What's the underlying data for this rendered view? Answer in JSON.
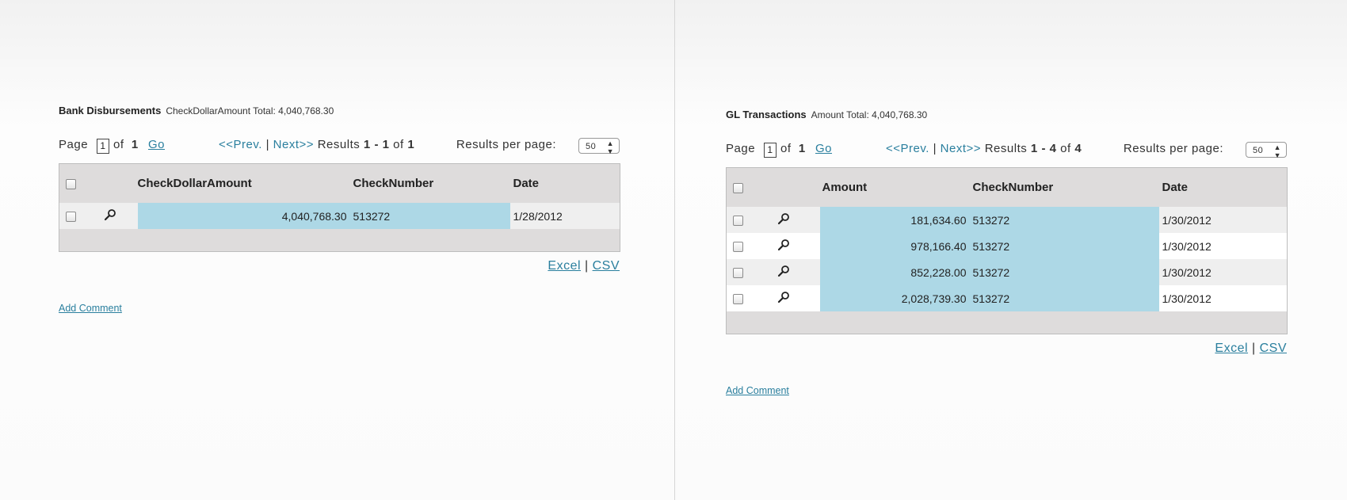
{
  "left": {
    "title": "Bank Disbursements",
    "total": "CheckDollarAmount Total: 4,040,768.30",
    "pager": {
      "page_label": "Page",
      "page_value": "1",
      "of_label": "of",
      "page_count": "1",
      "go": "Go",
      "prev": "<<Prev.",
      "sep": "|",
      "next": "Next>>",
      "results_label": "Results",
      "results_from": "1",
      "results_dash": "-",
      "results_to": "1",
      "results_of": "of",
      "results_total": "1",
      "rpp_label": "Results per page:",
      "rpp_value": "50"
    },
    "columns": [
      "CheckDollarAmount",
      "CheckNumber",
      "Date"
    ],
    "rows": [
      {
        "amount": "4,040,768.30",
        "check": "513272",
        "date": "1/28/2012"
      }
    ],
    "export": {
      "excel": "Excel",
      "sep": "|",
      "csv": "CSV"
    },
    "add_comment": "Add Comment"
  },
  "right": {
    "title": "GL Transactions",
    "total": "Amount Total: 4,040,768.30",
    "pager": {
      "page_label": "Page",
      "page_value": "1",
      "of_label": "of",
      "page_count": "1",
      "go": "Go",
      "prev": "<<Prev.",
      "sep": "|",
      "next": "Next>>",
      "results_label": "Results",
      "results_from": "1",
      "results_dash": "-",
      "results_to": "4",
      "results_of": "of",
      "results_total": "4",
      "rpp_label": "Results per page:",
      "rpp_value": "50"
    },
    "columns": [
      "Amount",
      "CheckNumber",
      "Date"
    ],
    "rows": [
      {
        "amount": "181,634.60",
        "check": "513272",
        "date": "1/30/2012"
      },
      {
        "amount": "978,166.40",
        "check": "513272",
        "date": "1/30/2012"
      },
      {
        "amount": "852,228.00",
        "check": "513272",
        "date": "1/30/2012"
      },
      {
        "amount": "2,028,739.30",
        "check": "513272",
        "date": "1/30/2012"
      }
    ],
    "export": {
      "excel": "Excel",
      "sep": "|",
      "csv": "CSV"
    },
    "add_comment": "Add Comment"
  },
  "icons": {
    "row_view": "magnifier-icon",
    "select": "checkbox"
  },
  "colors": {
    "link": "#2a7f9e",
    "highlight": "#add8e6",
    "header_bg": "#dedcdc",
    "odd_row": "#efefef"
  }
}
